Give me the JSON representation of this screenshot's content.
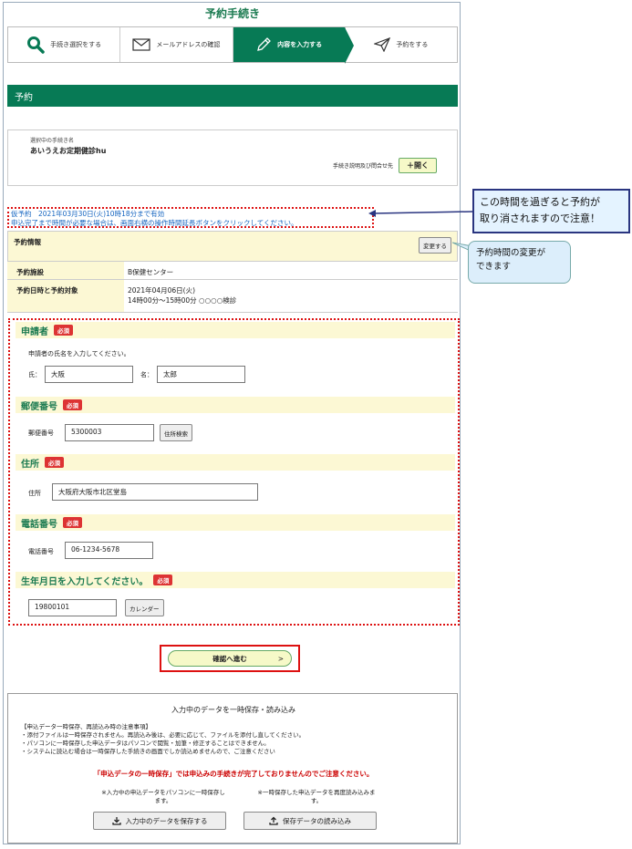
{
  "page_title": "予約手続き",
  "steps": [
    {
      "label": "手続き選択をする"
    },
    {
      "label": "メールアドレスの確認"
    },
    {
      "label": "内容を入力する"
    },
    {
      "label": "予約をする"
    }
  ],
  "section_title": "予約",
  "procedure": {
    "label": "選択中の手続き名",
    "name": "あいうえお定期健診hu",
    "link_label": "手続き説明及び問合せ先",
    "open_button": "＋開く"
  },
  "notice": {
    "line1": "仮予約　2021年03月30日(火)10時18分まで有効",
    "line2": "申込完了まで時間が必要な場合は、画面右横の操作時間延長ボタンをクリックしてください。"
  },
  "reservation": {
    "header": "予約情報",
    "change_button": "変更する",
    "facility_label": "予約施設",
    "facility_value": "B保健センター",
    "datetime_label": "予約日時と予約対象",
    "date_value": "2021年04月06日(火)",
    "time_value": "14時00分～15時00分 ○○○○検診"
  },
  "form": {
    "required": "必須",
    "applicant": {
      "title": "申請者",
      "desc": "申請者の氏名を入力してください。",
      "last_label": "氏：",
      "last_value": "大阪",
      "first_label": "名：",
      "first_value": "太郎"
    },
    "postal": {
      "title": "郵便番号",
      "label": "郵便番号",
      "value": "5300003",
      "search_button": "住所検索"
    },
    "address": {
      "title": "住所",
      "label": "住所",
      "value": "大阪府大阪市北区堂島"
    },
    "phone": {
      "title": "電話番号",
      "label": "電話番号",
      "value": "06-1234-5678"
    },
    "birthday": {
      "title": "生年月日を入力してください。",
      "value": "19800101",
      "calendar_button": "カレンダー"
    }
  },
  "next_button": "確認へ進む",
  "next_chevron": ">",
  "save_section": {
    "title": "入力中のデータを一時保存・読み込み",
    "notes_header": "【申込データ一時保存、再読込み時の注意事項】",
    "notes": [
      "・添付ファイルは一時保存されません。再読込み後は、必要に応じて、ファイルを添付し直してください。",
      "・パソコンに一時保存した申込データはパソコンで閲覧・加筆・修正することはできません。",
      "・システムに読込む場合は一時保存した手続きの画面でしか読込めませんので、ご注意ください"
    ],
    "warning": "「申込データの一時保存」では申込みの手続きが完了しておりませんのでご注意ください。",
    "save_note_1": "※入力中の申込データをパソコンに一時保存し",
    "save_note_2": "ます。",
    "load_note_1": "※一時保存した申込データを再度読み込みま",
    "load_note_2": "す。",
    "save_button": "入力中のデータを保存する",
    "load_button": "保存データの読み込み"
  },
  "callouts": {
    "expiry_1": "この時間を過ぎると予約が",
    "expiry_2": "取り消されますので注意！",
    "change_1": "予約時間の変更が",
    "change_2": "できます"
  }
}
